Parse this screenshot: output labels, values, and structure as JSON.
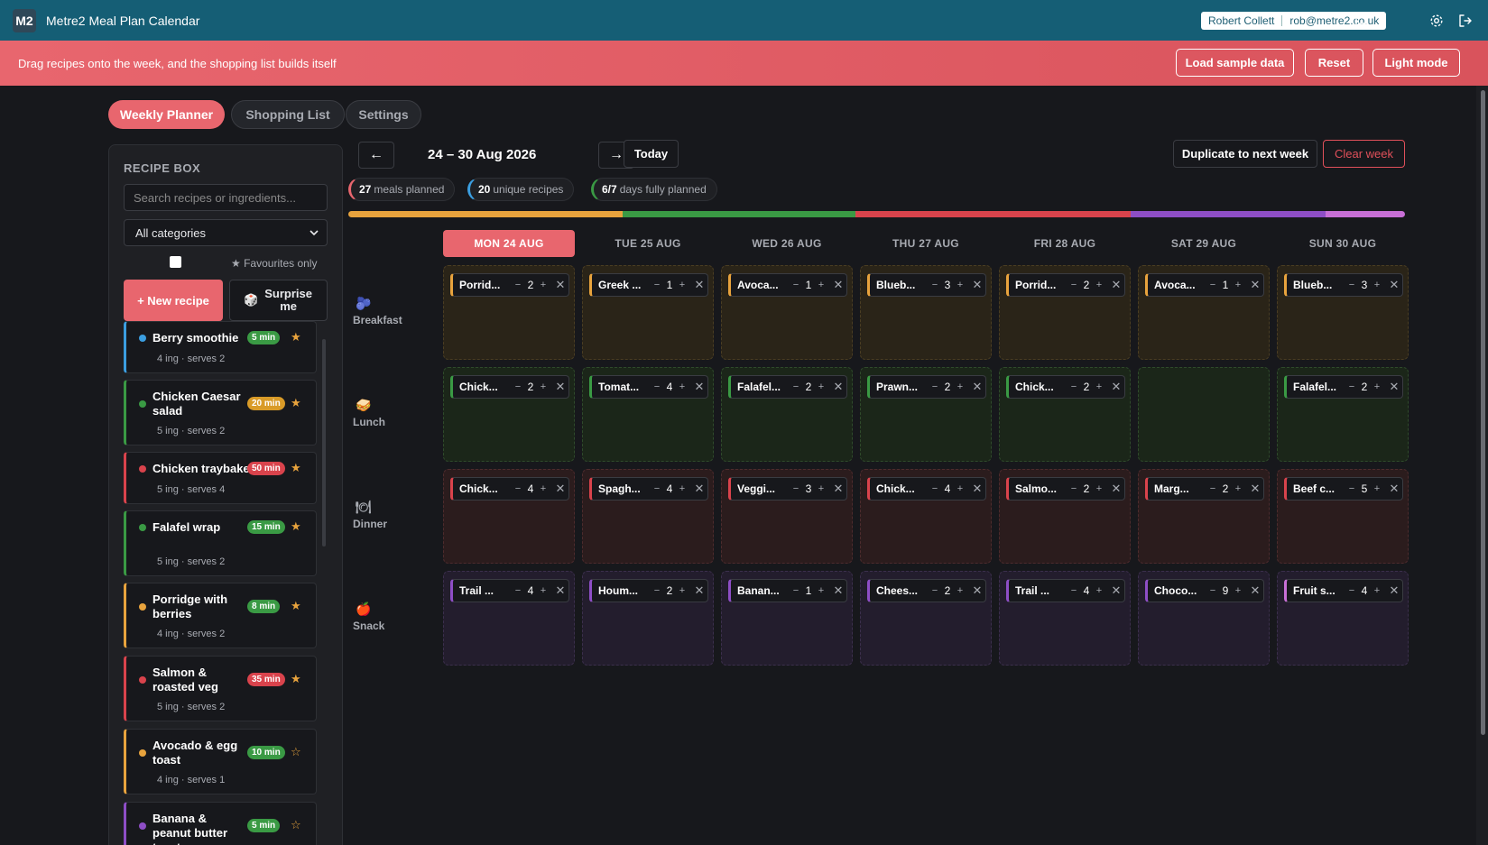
{
  "app": {
    "logo": "M2",
    "title": "Metre2 Meal Plan Calendar"
  },
  "user": {
    "name": "Robert Collett",
    "email": "rob@metre2.co.uk"
  },
  "titlebar_icons": [
    "chat-icon",
    "gear-icon",
    "logout-icon"
  ],
  "banner": {
    "text": "Drag recipes onto the week, and the shopping list builds itself",
    "load_sample": "Load sample data",
    "reset": "Reset",
    "light_mode": "Light mode"
  },
  "tabs": [
    {
      "label": "Weekly Planner",
      "active": true
    },
    {
      "label": "Shopping List",
      "active": false
    },
    {
      "label": "Settings",
      "active": false
    }
  ],
  "recipe_box": {
    "title": "RECIPE BOX",
    "search_placeholder": "Search recipes or ingredients...",
    "category": "All categories",
    "favourites_label": "★ Favourites only",
    "new_recipe": "+ New recipe",
    "surprise": "Surprise me",
    "recipes": [
      {
        "name": "Berry smoothie",
        "meta": "4 ing · serves 2",
        "time": "5 min",
        "color": "#3b9ee0",
        "time_color": "#3a9a44",
        "fav": true
      },
      {
        "name": "Chicken Caesar salad",
        "meta": "5 ing · serves 2",
        "time": "20 min",
        "color": "#3a9a44",
        "time_color": "#d99b28",
        "fav": true
      },
      {
        "name": "Chicken traybake",
        "meta": "5 ing · serves 4",
        "time": "50 min",
        "color": "#d9434c",
        "time_color": "#d9434c",
        "fav": true
      },
      {
        "name": "Falafel wrap",
        "meta": "5 ing · serves 2",
        "time": "15 min",
        "color": "#3a9a44",
        "time_color": "#3a9a44",
        "fav": true
      },
      {
        "name": "Porridge with berries",
        "meta": "4 ing · serves 2",
        "time": "8 min",
        "color": "#e8a33d",
        "time_color": "#3a9a44",
        "fav": true
      },
      {
        "name": "Salmon & roasted veg",
        "meta": "5 ing · serves 2",
        "time": "35 min",
        "color": "#d9434c",
        "time_color": "#d9434c",
        "fav": true
      },
      {
        "name": "Avocado & egg toast",
        "meta": "4 ing · serves 1",
        "time": "10 min",
        "color": "#e8a33d",
        "time_color": "#3a9a44",
        "fav": false
      },
      {
        "name": "Banana & peanut butter toast",
        "meta": "",
        "time": "5 min",
        "color": "#8e4ec6",
        "time_color": "#3a9a44",
        "fav": false
      }
    ]
  },
  "week": {
    "prev": "←",
    "next": "→",
    "label": "24 – 30 Aug 2026",
    "today": "Today",
    "duplicate": "Duplicate to next week",
    "clear": "Clear week"
  },
  "stats": [
    {
      "value": "27",
      "label": "meals planned",
      "color": "#e8666e"
    },
    {
      "value": "20",
      "label": "unique recipes",
      "color": "#3b9ee0"
    },
    {
      "value": "6/7",
      "label": "days fully planned",
      "color": "#3a9a44"
    }
  ],
  "progress_segments": [
    {
      "color": "#e8a33d",
      "fraction": 0.26
    },
    {
      "color": "#3a9a44",
      "fraction": 0.22
    },
    {
      "color": "#d9434c",
      "fraction": 0.26
    },
    {
      "color": "#8e4ec6",
      "fraction": 0.185
    },
    {
      "color": "#c86fd6",
      "fraction": 0.075
    }
  ],
  "days": [
    "MON 24 AUG",
    "TUE 25 AUG",
    "WED 26 AUG",
    "THU 27 AUG",
    "FRI 28 AUG",
    "SAT 29 AUG",
    "SUN 30 AUG"
  ],
  "today_index": 0,
  "meal_rows": [
    {
      "label": "Breakfast",
      "icon": "blueberry-icon",
      "glyph": "🫐",
      "accent": "#e8a33d",
      "cell_bg": "#2a2418",
      "cell_border": "#4a3d22",
      "entries": [
        {
          "name": "Porrid...",
          "qty": "2"
        },
        {
          "name": "Greek ...",
          "qty": "1"
        },
        {
          "name": "Avoca...",
          "qty": "1"
        },
        {
          "name": "Blueb...",
          "qty": "3"
        },
        {
          "name": "Porrid...",
          "qty": "2"
        },
        {
          "name": "Avoca...",
          "qty": "1"
        },
        {
          "name": "Blueb...",
          "qty": "3"
        }
      ]
    },
    {
      "label": "Lunch",
      "icon": "sandwich-icon",
      "glyph": "🥪",
      "accent": "#3a9a44",
      "cell_bg": "#1b2619",
      "cell_border": "#2f4a2b",
      "entries": [
        {
          "name": "Chick...",
          "qty": "2"
        },
        {
          "name": "Tomat...",
          "qty": "4"
        },
        {
          "name": "Falafel...",
          "qty": "2"
        },
        {
          "name": "Prawn...",
          "qty": "2"
        },
        {
          "name": "Chick...",
          "qty": "2"
        },
        null,
        {
          "name": "Falafel...",
          "qty": "2"
        }
      ]
    },
    {
      "label": "Dinner",
      "icon": "plate-icon",
      "glyph": "🍽",
      "accent": "#d9434c",
      "cell_bg": "#2b1c1d",
      "cell_border": "#4d2b2d",
      "entries": [
        {
          "name": "Chick...",
          "qty": "4"
        },
        {
          "name": "Spagh...",
          "qty": "4"
        },
        {
          "name": "Veggi...",
          "qty": "3"
        },
        {
          "name": "Chick...",
          "qty": "4"
        },
        {
          "name": "Salmo...",
          "qty": "2"
        },
        {
          "name": "Marg...",
          "qty": "2"
        },
        {
          "name": "Beef c...",
          "qty": "5"
        }
      ]
    },
    {
      "label": "Snack",
      "icon": "apple-icon",
      "glyph": "🍎",
      "accent": "#8e4ec6",
      "cell_bg": "#231d2d",
      "cell_border": "#3b2f4c",
      "entries": [
        {
          "name": "Trail ...",
          "qty": "4"
        },
        {
          "name": "Houm...",
          "qty": "2"
        },
        {
          "name": "Banan...",
          "qty": "1"
        },
        {
          "name": "Chees...",
          "qty": "2"
        },
        {
          "name": "Trail ...",
          "qty": "4"
        },
        {
          "name": "Choco...",
          "qty": "9"
        },
        {
          "name": "Fruit s...",
          "qty": "4",
          "accent": "#c86fd6"
        }
      ]
    }
  ],
  "slot_controls": {
    "minus": "−",
    "plus": "+",
    "remove": "✕"
  }
}
